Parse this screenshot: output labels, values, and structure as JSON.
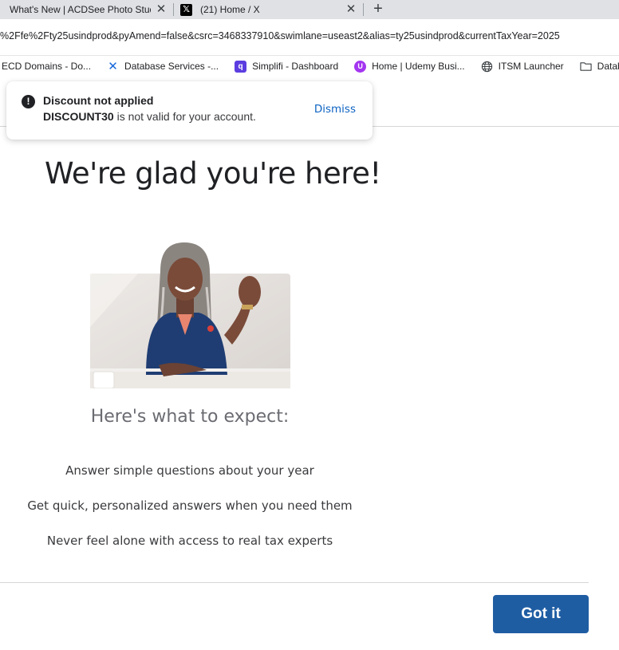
{
  "browser": {
    "tabs": [
      {
        "title": "What's New | ACDSee Photo Studio"
      },
      {
        "title": "(21) Home / X",
        "favicon": "x-logo-icon"
      }
    ],
    "url": "%2Ffe%2Fty25usindprod&pyAmend=false&csrc=3468337910&swimlane=useast2&alias=ty25usindprod&currentTaxYear=2025",
    "bookmarks": [
      {
        "label": "ECD Domains - Do...",
        "icon": ""
      },
      {
        "label": "Database Services -...",
        "icon": "confluence-icon"
      },
      {
        "label": "Simplifi - Dashboard",
        "icon": "simplifi-icon"
      },
      {
        "label": "Home | Udemy Busi...",
        "icon": "udemy-icon"
      },
      {
        "label": "ITSM Launcher",
        "icon": "globe-icon"
      },
      {
        "label": "Database",
        "icon": "folder-icon"
      }
    ]
  },
  "toast": {
    "title": "Discount not applied",
    "code": "DISCOUNT30",
    "message": " is not valid for your account.",
    "dismiss_label": "Dismiss",
    "icon": "exclamation-icon"
  },
  "main": {
    "headline": "We're glad you're here!",
    "subhead": "Here's what to expect:",
    "bullets": [
      "Answer simple questions about your year",
      "Get quick, personalized answers when you need them",
      "Never feel alone with access to real tax experts"
    ],
    "primary_button": "Got it"
  },
  "colors": {
    "button_bg": "#1f5da3",
    "link": "#0d63c3",
    "tab_strip": "#dfe1e5"
  }
}
